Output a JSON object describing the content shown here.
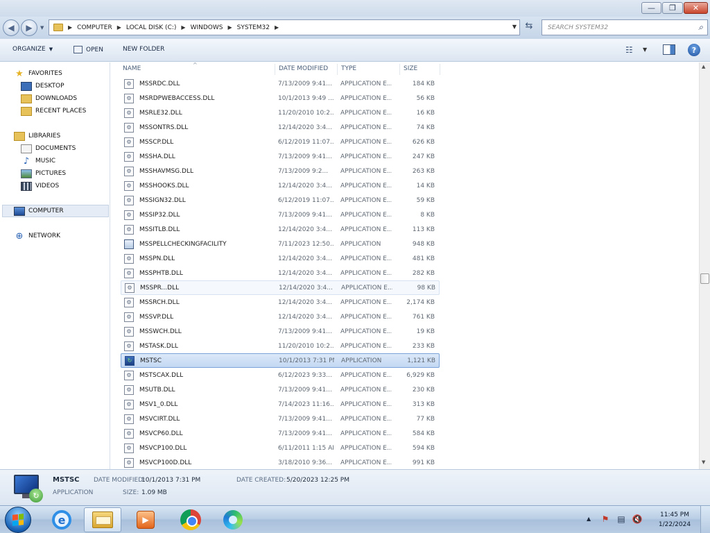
{
  "titlebar": {
    "minimize": "—",
    "maximize": "❐",
    "close": "✕"
  },
  "nav": {
    "breadcrumbs": [
      "Computer",
      "Local Disk (C:)",
      "Windows",
      "System32"
    ],
    "search_placeholder": "Search System32"
  },
  "toolbar": {
    "organize": "Organize",
    "open": "Open",
    "new_folder": "New folder"
  },
  "sidebar": {
    "favorites": "Favorites",
    "favorite_items": [
      "Desktop",
      "Downloads",
      "Recent Places"
    ],
    "libraries": "Libraries",
    "library_items": [
      "Documents",
      "Music",
      "Pictures",
      "Videos"
    ],
    "computer": "Computer",
    "network": "Network"
  },
  "columns": {
    "name": "Name",
    "date": "Date modified",
    "type": "Type",
    "size": "Size"
  },
  "files": [
    {
      "name": "mssrdc.dll",
      "date": "7/13/2009 9:41...",
      "type": "Application e...",
      "size": "184 KB",
      "icon": "dll"
    },
    {
      "name": "msrdpwebaccess.dll",
      "date": "10/1/2013 9:49 ...",
      "type": "Application e...",
      "size": "56 KB",
      "icon": "dll"
    },
    {
      "name": "msrle32.dll",
      "date": "11/20/2010 10:2...",
      "type": "Application e...",
      "size": "16 KB",
      "icon": "dll"
    },
    {
      "name": "mssoNtrs.dll",
      "date": "12/14/2020 3:4...",
      "type": "Application e...",
      "size": "74 KB",
      "icon": "dll"
    },
    {
      "name": "msscp.dll",
      "date": "6/12/2019 11:07...",
      "type": "Application e...",
      "size": "626 KB",
      "icon": "dll"
    },
    {
      "name": "mssha.dll",
      "date": "7/13/2009 9:41...",
      "type": "Application e...",
      "size": "247 KB",
      "icon": "dll"
    },
    {
      "name": "msshavmsg.dll",
      "date": "7/13/2009 9:2...",
      "type": "Application e...",
      "size": "263 KB",
      "icon": "dll"
    },
    {
      "name": "msshooks.dll",
      "date": "12/14/2020 3:4...",
      "type": "Application e...",
      "size": "14 KB",
      "icon": "dll"
    },
    {
      "name": "mssign32.dll",
      "date": "6/12/2019 11:07...",
      "type": "Application e...",
      "size": "59 KB",
      "icon": "dll"
    },
    {
      "name": "mssip32.dll",
      "date": "7/13/2009 9:41...",
      "type": "Application e...",
      "size": "8 KB",
      "icon": "dll"
    },
    {
      "name": "mssitlb.dll",
      "date": "12/14/2020 3:4...",
      "type": "Application e...",
      "size": "113 KB",
      "icon": "dll"
    },
    {
      "name": "MsSpellCheckingFacility",
      "date": "7/11/2023 12:50...",
      "type": "Application",
      "size": "948 KB",
      "icon": "app"
    },
    {
      "name": "msspn.dll",
      "date": "12/14/2020 3:4...",
      "type": "Application e...",
      "size": "481 KB",
      "icon": "dll"
    },
    {
      "name": "mssphtb.dll",
      "date": "12/14/2020 3:4...",
      "type": "Application e...",
      "size": "282 KB",
      "icon": "dll"
    },
    {
      "name": "msspr...dll",
      "date": "12/14/2020 3:4...",
      "type": "Application e...",
      "size": "98 KB",
      "icon": "dll",
      "state": "hover"
    },
    {
      "name": "mssrch.dll",
      "date": "12/14/2020 3:4...",
      "type": "Application e...",
      "size": "2,174 KB",
      "icon": "dll"
    },
    {
      "name": "mssvp.dll",
      "date": "12/14/2020 3:4...",
      "type": "Application e...",
      "size": "761 KB",
      "icon": "dll"
    },
    {
      "name": "msswch.dll",
      "date": "7/13/2009 9:41...",
      "type": "Application e...",
      "size": "19 KB",
      "icon": "dll"
    },
    {
      "name": "mstask.dll",
      "date": "11/20/2010 10:2...",
      "type": "Application e...",
      "size": "233 KB",
      "icon": "dll"
    },
    {
      "name": "mstsc",
      "date": "10/1/2013 7:31 PM",
      "type": "Application",
      "size": "1,121 KB",
      "icon": "rdp",
      "state": "selected"
    },
    {
      "name": "mstscax.dll",
      "date": "6/12/2023 9:33...",
      "type": "Application e...",
      "size": "6,929 KB",
      "icon": "dll"
    },
    {
      "name": "msutb.dll",
      "date": "7/13/2009 9:41...",
      "type": "Application e...",
      "size": "230 KB",
      "icon": "dll"
    },
    {
      "name": "msv1_0.dll",
      "date": "7/14/2023 11:16...",
      "type": "Application e...",
      "size": "313 KB",
      "icon": "dll"
    },
    {
      "name": "msvcirt.dll",
      "date": "7/13/2009 9:41...",
      "type": "Application e...",
      "size": "77 KB",
      "icon": "dll"
    },
    {
      "name": "msvcp60.dll",
      "date": "7/13/2009 9:41...",
      "type": "Application e...",
      "size": "584 KB",
      "icon": "dll"
    },
    {
      "name": "msvcp100.dll",
      "date": "6/11/2011 1:15 AM",
      "type": "Application e...",
      "size": "594 KB",
      "icon": "dll"
    },
    {
      "name": "msvcp100d.dll",
      "date": "3/18/2010 9:36...",
      "type": "Application e...",
      "size": "991 KB",
      "icon": "dll"
    }
  ],
  "details": {
    "name": "mstsc",
    "kind": "Application",
    "date_modified_label": "Date modified:",
    "date_modified": "10/1/2013 7:31 PM",
    "date_created_label": "Date created:",
    "date_created": "5/20/2023 12:25 PM",
    "size_label": "Size:",
    "size": "1.09 MB"
  },
  "taskbar": {
    "time": "11:45 PM",
    "date": "1/22/2024",
    "items": [
      "internet-explorer-icon",
      "explorer-icon",
      "media-player-icon",
      "chrome-icon",
      "edge-icon"
    ]
  }
}
